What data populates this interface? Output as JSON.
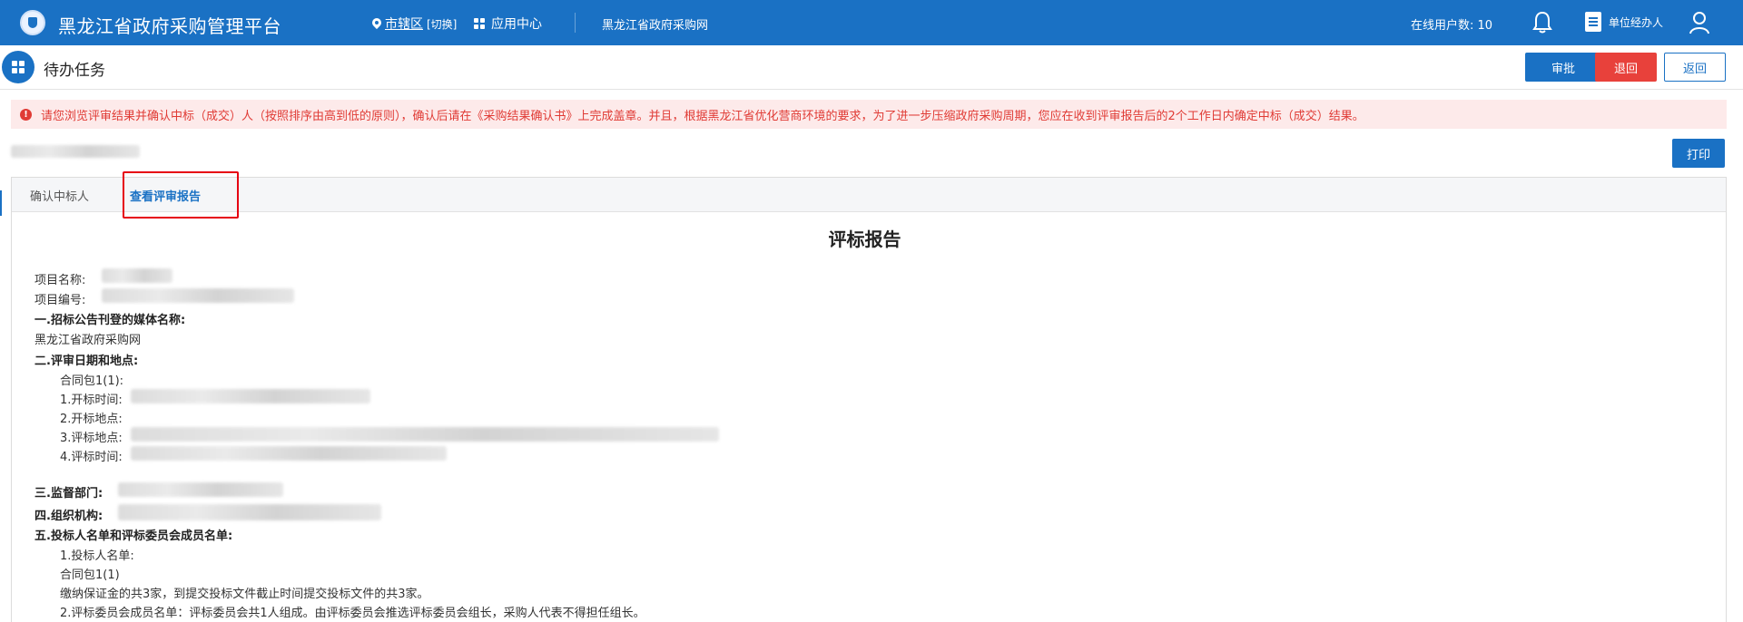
{
  "app": {
    "title": "黑龙江省政府采购管理平台",
    "region_name": "市辖区",
    "region_switch": "[切换]",
    "app_center": "应用中心",
    "portal_link": "黑龙江省政府采购网",
    "online_users": "在线用户数:  10",
    "unit_manager": "单位经办人"
  },
  "page": {
    "title": "待办任务",
    "approve_label": "审批",
    "reject_label": "退回",
    "back_label": "返回",
    "print_label": "打印"
  },
  "alert": {
    "text": "请您浏览评审结果并确认中标（成交）人（按照排序由高到低的原则），确认后请在《采购结果确认书》上完成盖章。并且，根据黑龙江省优化营商环境的要求，为了进一步压缩政府采购周期，您应在收到评审报告后的2个工作日内确定中标（成交）结果。"
  },
  "tabs": [
    {
      "label": "确认中标人"
    },
    {
      "label": "查看评审报告"
    }
  ],
  "report": {
    "title": "评标报告",
    "project_name_label": "项目名称:",
    "project_code_label": "项目编号:",
    "section1_title": "一.招标公告刊登的媒体名称:",
    "section1_value": "黑龙江省政府采购网",
    "section2_title": "二.评审日期和地点:",
    "package": "合同包1(1):",
    "open_time": "1.开标时间:",
    "open_place": "2.开标地点:",
    "eval_place": "3.评标地点:",
    "eval_time": "4.评标时间:",
    "section3_title": "三.监督部门:",
    "section4_title": "四.组织机构:",
    "section5_title": "五.投标人名单和评标委员会成员名单:",
    "bidder_list": "1.投标人名单:",
    "bidder_package": "合同包1(1)",
    "bidder_summary": "缴纳保证金的共3家，到提交投标文件截止时间提交投标文件的共3家。",
    "committee": "2.评标委员会成员名单：评标委员会共1人组成。由评标委员会推选评标委员会组长，采购人代表不得担任组长。"
  },
  "colors": {
    "primary": "#1a71c4",
    "danger": "#e8413b",
    "alert_bg": "#fdeaea",
    "alert_text": "#e03b35",
    "highlight": "#e60012"
  }
}
